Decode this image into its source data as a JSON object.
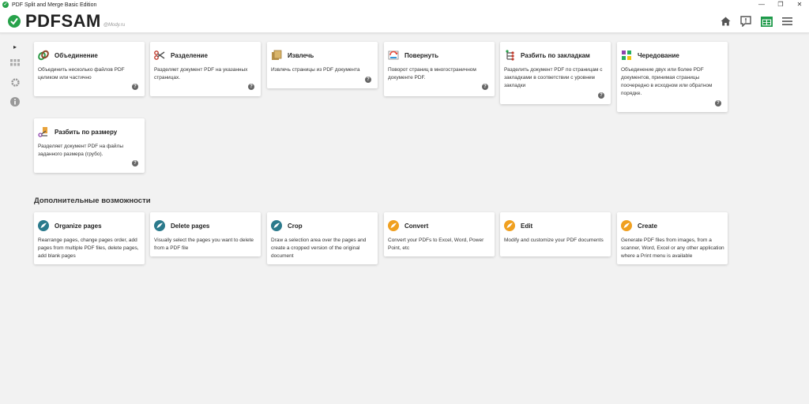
{
  "window": {
    "title": "PDF Split and Merge Basic Edition",
    "minimize": "—",
    "maximize": "❐",
    "close": "✕"
  },
  "header": {
    "logo_text": "PDFSAM",
    "logo_sub": "@Mody.ru",
    "icons": [
      "home-icon",
      "news-icon",
      "modules-icon",
      "menu-icon"
    ]
  },
  "sidebar": {
    "collapse": "▸",
    "items": [
      "grid-icon",
      "settings-icon",
      "info-icon"
    ]
  },
  "modules": [
    {
      "title": "Объединение",
      "desc": "Объединить несколько файлов PDF целиком или частично",
      "icon": "merge-icon"
    },
    {
      "title": "Разделение",
      "desc": "Разделяет документ PDF на указанных страницах.",
      "icon": "split-icon"
    },
    {
      "title": "Извлечь",
      "desc": "Извлечь страницы из PDF документа",
      "icon": "extract-icon"
    },
    {
      "title": "Повернуть",
      "desc": "Поворот страниц в многостраничном документе PDF.",
      "icon": "rotate-icon"
    },
    {
      "title": "Разбить по закладкам",
      "desc": "Разделить документ PDF по страницам с закладками в соответствии с уровнем закладки",
      "icon": "split-bookmarks-icon"
    },
    {
      "title": "Чередование",
      "desc": "Объединение двух или более PDF документов, принимая страницы поочередно в исходном или обратном порядке.",
      "icon": "alternate-mix-icon"
    },
    {
      "title": "Разбить по размеру",
      "desc": "Разделяет документ PDF на файлы заданного размера (грубо).",
      "icon": "split-size-icon"
    }
  ],
  "help_label": "?",
  "extra": {
    "section_title": "Дополнительные возможности",
    "items": [
      {
        "title": "Organize pages",
        "desc": "Rearrange pages, change pages order, add pages from multiple PDF files, delete pages, add blank pages",
        "icon": "organize-icon"
      },
      {
        "title": "Delete pages",
        "desc": "Visually select the pages you want to delete from a PDF file",
        "icon": "delete-pages-icon"
      },
      {
        "title": "Crop",
        "desc": "Draw a selection area over the pages and create a cropped version of the original document",
        "icon": "crop-icon"
      },
      {
        "title": "Convert",
        "desc": "Convert your PDFs to Excel, Word, Power Point, etc",
        "icon": "convert-icon"
      },
      {
        "title": "Edit",
        "desc": "Modify and customize your PDF documents",
        "icon": "edit-icon"
      },
      {
        "title": "Create",
        "desc": "Generate PDF files from images, from a scanner, Word, Excel or any other application where a Print menu is available",
        "icon": "create-icon"
      }
    ]
  },
  "colors": {
    "accent_green": "#27a24a",
    "teal": "#2b7a8c",
    "orange": "#f0a020"
  }
}
